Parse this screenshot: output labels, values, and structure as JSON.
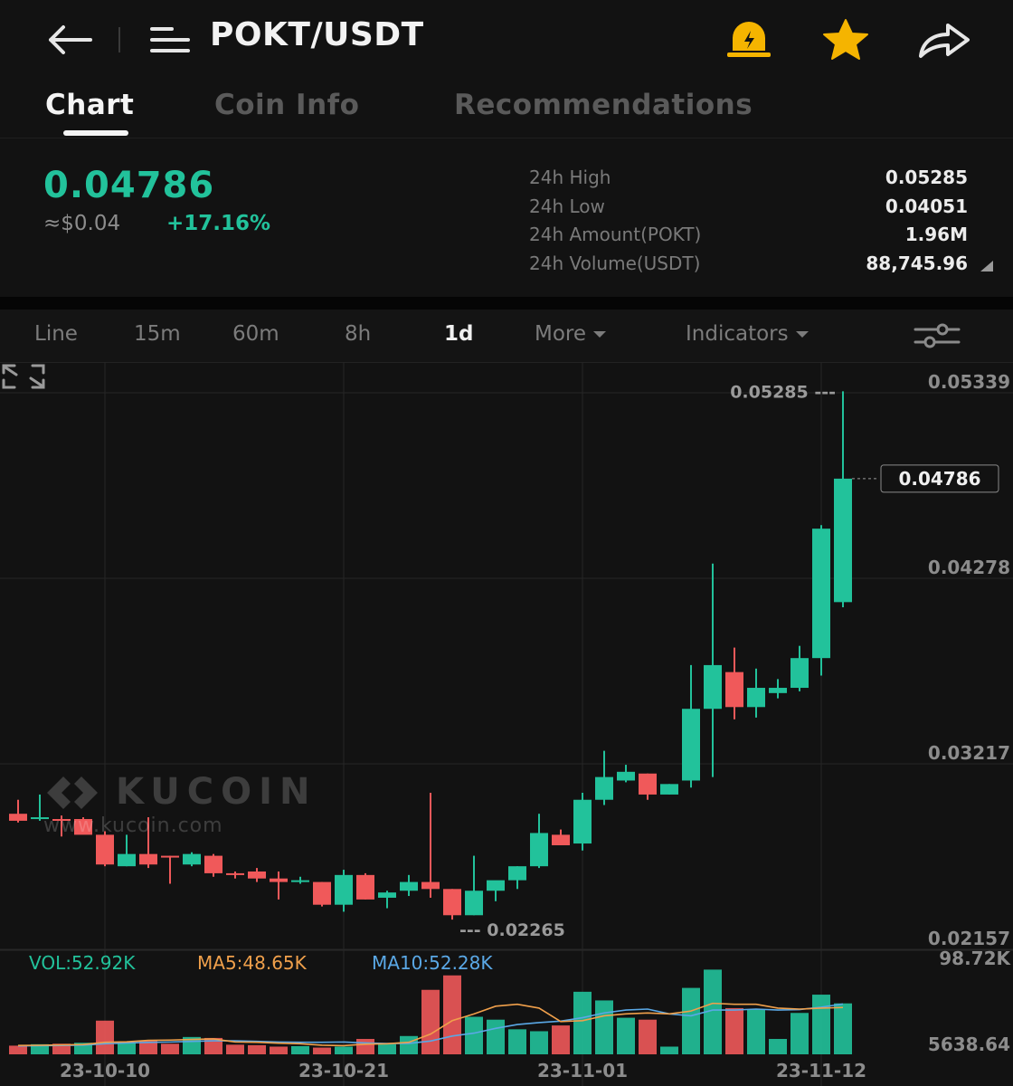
{
  "header": {
    "pair": "POKT/USDT",
    "icons": [
      "back-arrow-icon",
      "menu-icon",
      "alarm-icon",
      "star-icon",
      "share-icon"
    ]
  },
  "tabs": [
    {
      "label": "Chart",
      "active": true
    },
    {
      "label": "Coin Info",
      "active": false
    },
    {
      "label": "Recommendations",
      "active": false
    }
  ],
  "ticker": {
    "last_price": "0.04786",
    "fiat": "≈$0.04",
    "change": "+17.16%",
    "stats": [
      {
        "label": "24h High",
        "value": "0.05285"
      },
      {
        "label": "24h Low",
        "value": "0.04051"
      },
      {
        "label": "24h Amount(POKT)",
        "value": "1.96M"
      },
      {
        "label": "24h Volume(USDT)",
        "value": "88,745.96"
      }
    ]
  },
  "timeframes": [
    {
      "label": "Line",
      "active": false,
      "dropdown": false
    },
    {
      "label": "15m",
      "active": false,
      "dropdown": false
    },
    {
      "label": "60m",
      "active": false,
      "dropdown": false
    },
    {
      "label": "8h",
      "active": false,
      "dropdown": false
    },
    {
      "label": "1d",
      "active": true,
      "dropdown": false
    },
    {
      "label": "More",
      "active": false,
      "dropdown": true
    },
    {
      "label": "Indicators",
      "active": false,
      "dropdown": true
    }
  ],
  "watermark": {
    "brand": "KUCOIN",
    "url": "www.kucoin.com"
  },
  "volume_legend": {
    "vol": "VOL:52.92K",
    "ma5": "MA5:48.65K",
    "ma10": "MA10:52.28K"
  },
  "colors": {
    "up": "#22c29b",
    "down": "#f0595a",
    "ma5": "#f0a04b",
    "ma10": "#5aa8e6",
    "background": "#121212"
  },
  "chart_data": {
    "type": "candlestick",
    "price_axis_labels": [
      "0.05339",
      "0.04278",
      "0.03217",
      "0.02157"
    ],
    "price_range": [
      0.02157,
      0.05339
    ],
    "current_price_label": "0.04786",
    "current_price": 0.04786,
    "high_marker": {
      "label": "0.05285",
      "value": 0.05285
    },
    "low_marker": {
      "label": "0.02265",
      "value": 0.02265
    },
    "volume_axis_labels": [
      "98.72K",
      "5638.64"
    ],
    "volume_range": [
      5638.64,
      98720
    ],
    "date_labels": [
      {
        "label": "23-10-10",
        "index": 4
      },
      {
        "label": "23-10-21",
        "index": 15
      },
      {
        "label": "23-11-01",
        "index": 26
      },
      {
        "label": "23-11-12",
        "index": 37
      }
    ],
    "candles": [
      {
        "o": 0.0287,
        "h": 0.0295,
        "l": 0.0282,
        "c": 0.0283
      },
      {
        "o": 0.0284,
        "h": 0.0298,
        "l": 0.0283,
        "c": 0.0285
      },
      {
        "o": 0.0284,
        "h": 0.0286,
        "l": 0.0274,
        "c": 0.0283
      },
      {
        "o": 0.0284,
        "h": 0.0285,
        "l": 0.0276,
        "c": 0.0275
      },
      {
        "o": 0.0275,
        "h": 0.0277,
        "l": 0.0257,
        "c": 0.0258
      },
      {
        "o": 0.0257,
        "h": 0.0275,
        "l": 0.0257,
        "c": 0.0264
      },
      {
        "o": 0.0264,
        "h": 0.0285,
        "l": 0.0256,
        "c": 0.0258
      },
      {
        "o": 0.0263,
        "h": 0.0263,
        "l": 0.0247,
        "c": 0.0262
      },
      {
        "o": 0.0258,
        "h": 0.0265,
        "l": 0.0257,
        "c": 0.0264
      },
      {
        "o": 0.0263,
        "h": 0.0264,
        "l": 0.0251,
        "c": 0.0253
      },
      {
        "o": 0.0253,
        "h": 0.0254,
        "l": 0.025,
        "c": 0.0252
      },
      {
        "o": 0.0254,
        "h": 0.0256,
        "l": 0.0248,
        "c": 0.025
      },
      {
        "o": 0.025,
        "h": 0.0254,
        "l": 0.0238,
        "c": 0.0248
      },
      {
        "o": 0.0248,
        "h": 0.0251,
        "l": 0.0247,
        "c": 0.0249
      },
      {
        "o": 0.0248,
        "h": 0.0248,
        "l": 0.0234,
        "c": 0.0235
      },
      {
        "o": 0.0235,
        "h": 0.0255,
        "l": 0.0231,
        "c": 0.0252
      },
      {
        "o": 0.0252,
        "h": 0.0253,
        "l": 0.0238,
        "c": 0.0238
      },
      {
        "o": 0.0239,
        "h": 0.0243,
        "l": 0.0233,
        "c": 0.0242
      },
      {
        "o": 0.0243,
        "h": 0.0252,
        "l": 0.024,
        "c": 0.0248
      },
      {
        "o": 0.0248,
        "h": 0.0299,
        "l": 0.0239,
        "c": 0.0244
      },
      {
        "o": 0.0244,
        "h": 0.0244,
        "l": 0.02265,
        "c": 0.0229
      },
      {
        "o": 0.0229,
        "h": 0.0263,
        "l": 0.0229,
        "c": 0.0243
      },
      {
        "o": 0.0243,
        "h": 0.0248,
        "l": 0.0237,
        "c": 0.0249
      },
      {
        "o": 0.0249,
        "h": 0.0257,
        "l": 0.0244,
        "c": 0.0257
      },
      {
        "o": 0.0257,
        "h": 0.0287,
        "l": 0.0256,
        "c": 0.0276
      },
      {
        "o": 0.0275,
        "h": 0.0278,
        "l": 0.0269,
        "c": 0.0269
      },
      {
        "o": 0.027,
        "h": 0.0299,
        "l": 0.0266,
        "c": 0.0295
      },
      {
        "o": 0.0295,
        "h": 0.0323,
        "l": 0.0292,
        "c": 0.0308
      },
      {
        "o": 0.0306,
        "h": 0.0315,
        "l": 0.0305,
        "c": 0.0311
      },
      {
        "o": 0.031,
        "h": 0.031,
        "l": 0.0295,
        "c": 0.0298
      },
      {
        "o": 0.0298,
        "h": 0.0304,
        "l": 0.0298,
        "c": 0.0304
      },
      {
        "o": 0.0306,
        "h": 0.0372,
        "l": 0.0302,
        "c": 0.0347
      },
      {
        "o": 0.0347,
        "h": 0.043,
        "l": 0.0308,
        "c": 0.0372
      },
      {
        "o": 0.0368,
        "h": 0.0382,
        "l": 0.0341,
        "c": 0.0348
      },
      {
        "o": 0.0348,
        "h": 0.037,
        "l": 0.0342,
        "c": 0.0359
      },
      {
        "o": 0.0356,
        "h": 0.0364,
        "l": 0.0353,
        "c": 0.0359
      },
      {
        "o": 0.0359,
        "h": 0.0383,
        "l": 0.0357,
        "c": 0.0376
      },
      {
        "o": 0.0376,
        "h": 0.0452,
        "l": 0.0366,
        "c": 0.045
      },
      {
        "o": 0.0408,
        "h": 0.05285,
        "l": 0.04051,
        "c": 0.04786
      }
    ],
    "volume": [
      {
        "v": 9000,
        "up": false
      },
      {
        "v": 10500,
        "up": true
      },
      {
        "v": 11000,
        "up": false
      },
      {
        "v": 12000,
        "up": true
      },
      {
        "v": 35000,
        "up": false
      },
      {
        "v": 12500,
        "up": true
      },
      {
        "v": 14000,
        "up": false
      },
      {
        "v": 11000,
        "up": false
      },
      {
        "v": 18000,
        "up": true
      },
      {
        "v": 17000,
        "up": false
      },
      {
        "v": 10000,
        "up": false
      },
      {
        "v": 9500,
        "up": false
      },
      {
        "v": 8000,
        "up": false
      },
      {
        "v": 8500,
        "up": true
      },
      {
        "v": 7000,
        "up": false
      },
      {
        "v": 8000,
        "up": true
      },
      {
        "v": 16000,
        "up": false
      },
      {
        "v": 10500,
        "up": true
      },
      {
        "v": 19000,
        "up": true
      },
      {
        "v": 67000,
        "up": false
      },
      {
        "v": 82000,
        "up": false
      },
      {
        "v": 39000,
        "up": true
      },
      {
        "v": 36000,
        "up": true
      },
      {
        "v": 26000,
        "up": true
      },
      {
        "v": 24000,
        "up": true
      },
      {
        "v": 30000,
        "up": false
      },
      {
        "v": 65000,
        "up": true
      },
      {
        "v": 56000,
        "up": true
      },
      {
        "v": 38000,
        "up": true
      },
      {
        "v": 36000,
        "up": false
      },
      {
        "v": 8000,
        "up": true
      },
      {
        "v": 69000,
        "up": true
      },
      {
        "v": 88000,
        "up": true
      },
      {
        "v": 48000,
        "up": false
      },
      {
        "v": 47000,
        "up": true
      },
      {
        "v": 16000,
        "up": true
      },
      {
        "v": 43000,
        "up": true
      },
      {
        "v": 62000,
        "up": true
      },
      {
        "v": 52920,
        "up": true
      }
    ],
    "ma5": [
      9200,
      9400,
      9800,
      10200,
      12500,
      13000,
      14500,
      14800,
      15500,
      16000,
      12800,
      12500,
      11600,
      11000,
      9500,
      9000,
      10500,
      11000,
      12500,
      21000,
      35000,
      42000,
      50000,
      52000,
      48000,
      34000,
      35000,
      40000,
      42000,
      43000,
      42000,
      45000,
      53000,
      52000,
      52000,
      48000,
      47000,
      48000,
      48650
    ],
    "ma10": [
      8800,
      9000,
      9200,
      9600,
      11000,
      11800,
      12400,
      12800,
      13500,
      14000,
      14000,
      13500,
      12800,
      12500,
      12500,
      12800,
      11800,
      11200,
      11300,
      13800,
      19000,
      22000,
      27000,
      31000,
      33000,
      34500,
      38000,
      43000,
      46000,
      47000,
      42000,
      40000,
      46000,
      46000,
      47000,
      46000,
      46500,
      49000,
      52280
    ]
  }
}
